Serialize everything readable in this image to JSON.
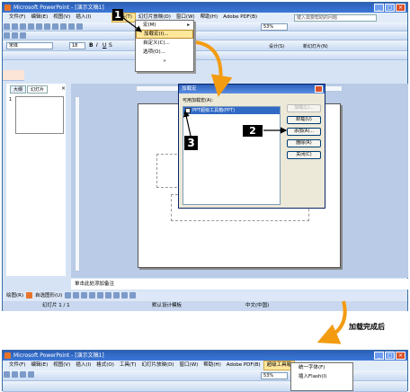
{
  "window1": {
    "title": "Microsoft PowerPoint - [演示文稿1]",
    "menu": [
      "文件(F)",
      "编辑(E)",
      "视图(V)",
      "插入(I)",
      "格式(O)",
      "工具(T)",
      "幻灯片放映(D)",
      "窗口(W)",
      "帮助(H)",
      "Adobe PDF(B)"
    ],
    "help_placeholder": "键入需要帮助的问题",
    "font": "宋体",
    "font_size": "18",
    "zoom": "53%",
    "design_label": "设计(S)",
    "new_slide_label": "新幻灯片(N)",
    "tab_outline": "大纲",
    "tab_slides": "幻灯片",
    "slide_number": "1",
    "notes_placeholder": "单击此处添加备注",
    "draw_label": "绘图(R)",
    "autoshapes_label": "自选图形(U)",
    "status_slide": "幻灯片 1 / 1",
    "status_design": "默认设计模板",
    "status_lang": "中文(中国)"
  },
  "tools_menu": {
    "items": [
      "宏(M)",
      "加载宏(I)...",
      "自定义(C)...",
      "选项(O)..."
    ],
    "more": "»"
  },
  "dialog": {
    "title": "加载宏",
    "list_label": "可用加载宏(A):",
    "list_item": "PPT超级工具箱(PPT)",
    "buttons": [
      "加载(L)...",
      "卸载(U)",
      "添加(A)...",
      "删除(R)",
      "关闭(C)"
    ]
  },
  "badges": [
    "1",
    "2",
    "3"
  ],
  "caption": "加载完成后",
  "window2": {
    "title": "Microsoft PowerPoint - [演示文稿1]",
    "menu": [
      "文件(F)",
      "编辑(E)",
      "视图(V)",
      "插入(I)",
      "格式(O)",
      "工具(T)",
      "幻灯片放映(D)",
      "窗口(W)",
      "帮助(H)",
      "Adobe PDF(B)",
      "超级工具箱"
    ],
    "zoom": "53%",
    "dropdown_items": [
      "统一字体(F)",
      "插入Flash(I)"
    ]
  },
  "colors": {
    "accent_orange": "#f39c12",
    "highlight": "#ffe79c",
    "selection": "#316ac5"
  }
}
